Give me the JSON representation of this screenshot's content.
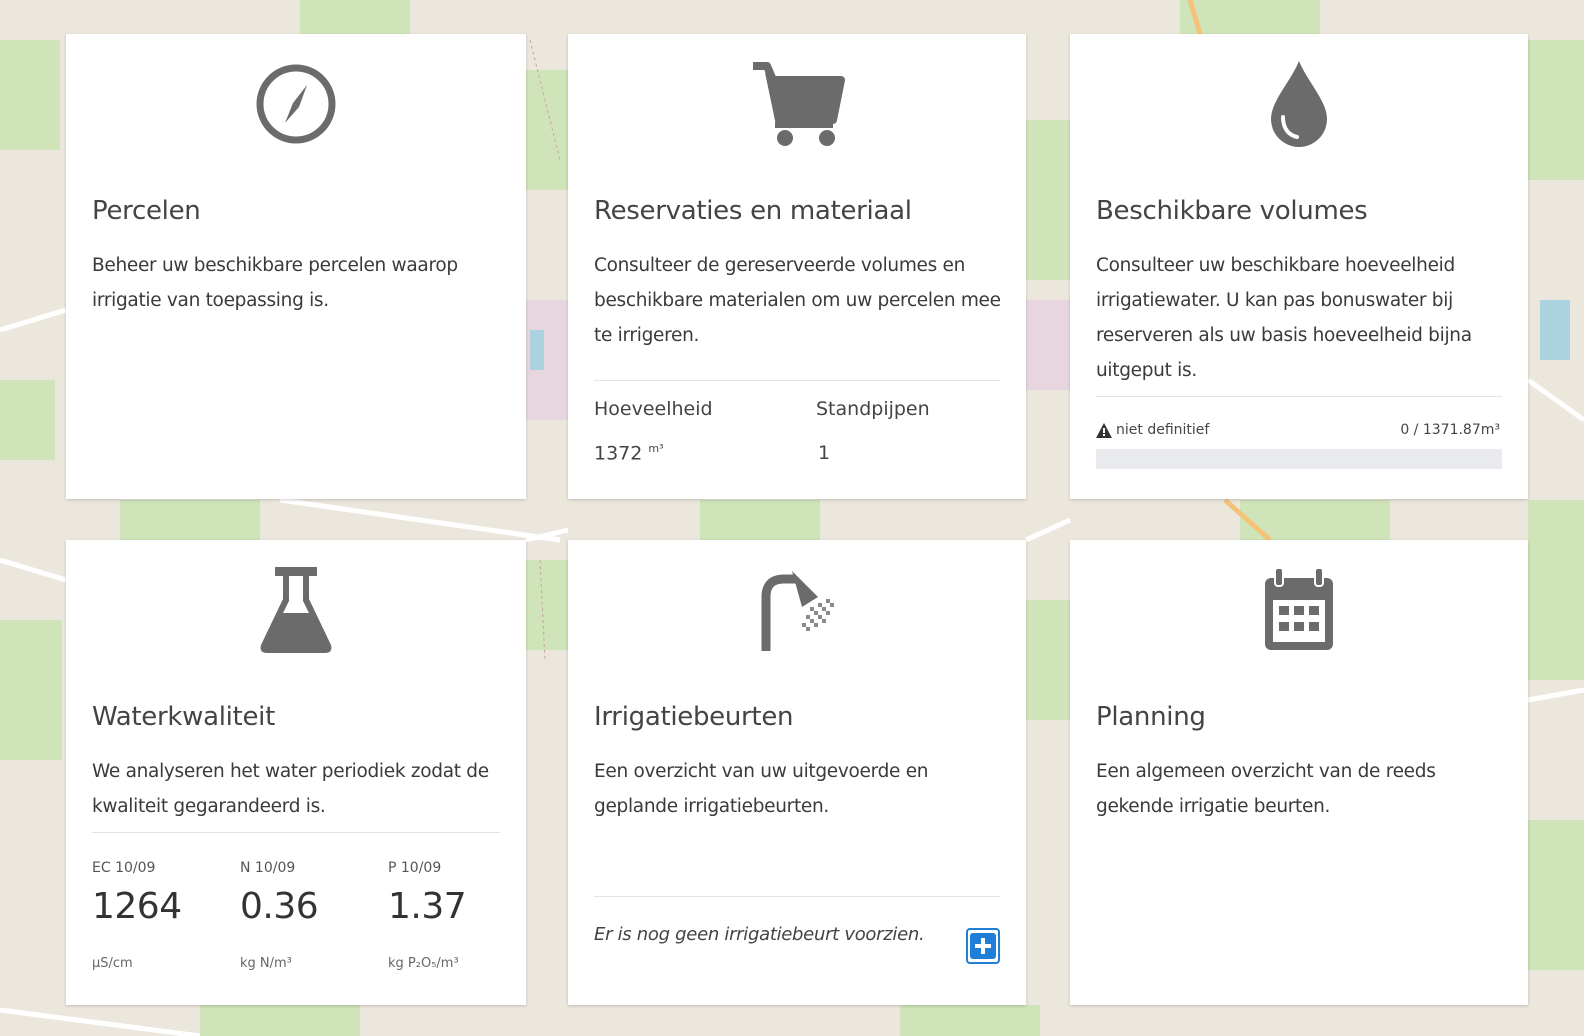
{
  "colors": {
    "icon": "#6b6b6b",
    "accent": "#1e7ed8",
    "card_bg": "#ffffff",
    "map_bg": "#eae6dc"
  },
  "cards": {
    "percelen": {
      "icon": "compass-icon",
      "title": "Percelen",
      "description": "Beheer uw beschikbare percelen waarop irrigatie van toepassing is."
    },
    "reservaties": {
      "icon": "cart-icon",
      "title": "Reservaties en materiaal",
      "description": "Consulteer de gereserveerde volumes en beschikbare materialen om uw percelen mee te irrigeren.",
      "stats": {
        "quantity_label": "Hoeveelheid",
        "quantity_value": "1372",
        "quantity_unit": "m³",
        "standpipes_label": "Standpijpen",
        "standpipes_value": "1"
      }
    },
    "volumes": {
      "icon": "water-drop-icon",
      "title": "Beschikbare volumes",
      "description": "Consulteer uw beschikbare hoeveelheid irrigatiewater. U kan pas bonuswater bij reserveren als uw basis hoeveelheid bijna uitgeput is.",
      "status_icon": "warning-icon",
      "status_text": "niet definitief",
      "volume_text": "0  /  1371.87m³",
      "used": 0,
      "total": 1371.87,
      "fraction": 0
    },
    "waterkwaliteit": {
      "icon": "flask-icon",
      "title": "Waterkwaliteit",
      "description": "We analyseren het water periodiek zodat de kwaliteit gegarandeerd is.",
      "metrics": [
        {
          "label": "EC 10/09",
          "value": "1264",
          "unit": "µS/cm"
        },
        {
          "label": "N 10/09",
          "value": "0.36",
          "unit": "kg N/m³"
        },
        {
          "label": "P 10/09",
          "value": "1.37",
          "unit": "kg P₂O₅/m³"
        }
      ]
    },
    "irrigatiebeurten": {
      "icon": "shower-icon",
      "title": "Irrigatiebeurten",
      "description": "Een overzicht van uw uitgevoerde en geplande irrigatiebeurten.",
      "empty_text": "Er is nog geen irrigatiebeurt voorzien.",
      "add_icon": "plus-square-icon"
    },
    "planning": {
      "icon": "calendar-icon",
      "title": "Planning",
      "description": "Een algemeen overzicht van de reeds gekende irrigatie beurten."
    }
  }
}
